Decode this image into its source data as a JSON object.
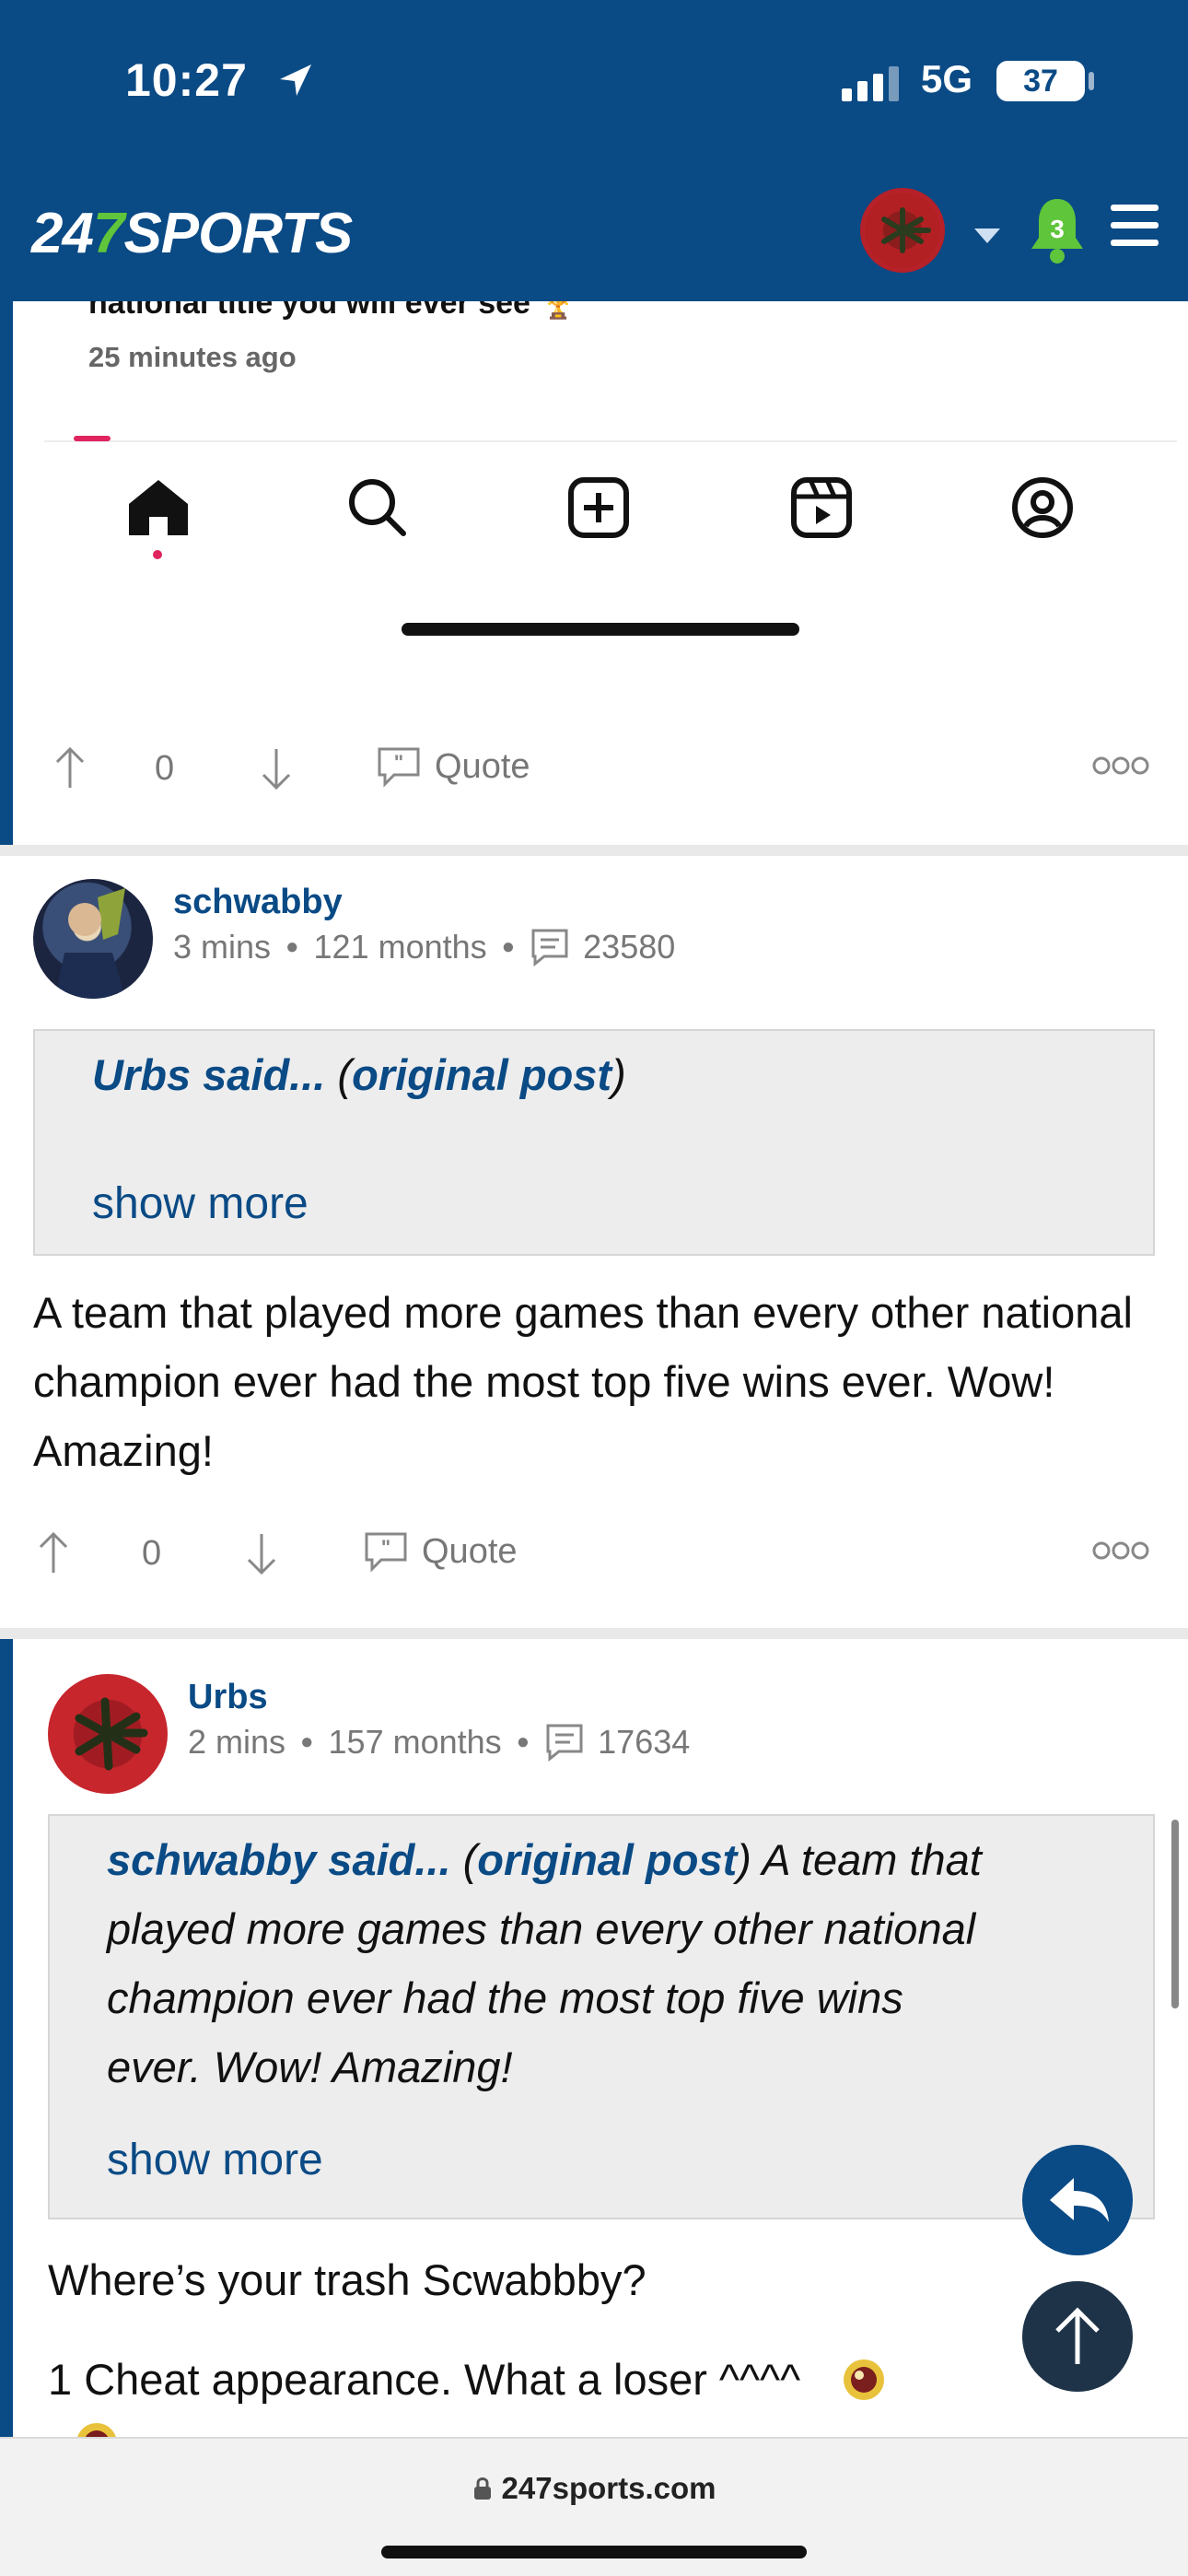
{
  "status_bar": {
    "time": "10:27",
    "network": "5G",
    "battery": "37"
  },
  "header": {
    "logo_left": "24",
    "logo_seven": "7",
    "logo_right": "SPORTS",
    "notification_count": "3"
  },
  "post_prev": {
    "partial_text": "national title you will ever see 🏆",
    "timestamp": "25 minutes ago",
    "votes": "0",
    "quote_label": "Quote"
  },
  "post_schwabby": {
    "username": "schwabby",
    "time": "3 mins",
    "tenure": "121 months",
    "post_count": "23580",
    "quote": {
      "author_said": "Urbs said...",
      "open_paren": " (",
      "original_post": "original post",
      "close_paren": ")"
    },
    "show_more": "show more",
    "body": "A team that played more games than every other national champion ever had the most top five wins ever. Wow! Amazing!",
    "votes": "0",
    "quote_label": "Quote"
  },
  "post_urbs": {
    "username": "Urbs",
    "time": "2 mins",
    "tenure": "157 months",
    "post_count": "17634",
    "quote": {
      "author_said": "schwabby said...",
      "open_paren": " (",
      "original_post": "original post",
      "close_paren": ")",
      "text_line1": " A team that",
      "text_line2": "played more games than every other national",
      "text_line3": "champion ever had the most top five wins",
      "text_line4": "ever. Wow! Amazing!"
    },
    "show_more": "show more",
    "body_line1": "Where’s your trash Scwabbby?",
    "body_line2": "1 Cheat appearance. What a loser ^^^^"
  },
  "url_bar": {
    "domain": "247sports.com"
  },
  "colors": {
    "brand_blue": "#0a4a85",
    "brand_green": "#5fc53a",
    "scroll_top_button": "#1e3348"
  }
}
